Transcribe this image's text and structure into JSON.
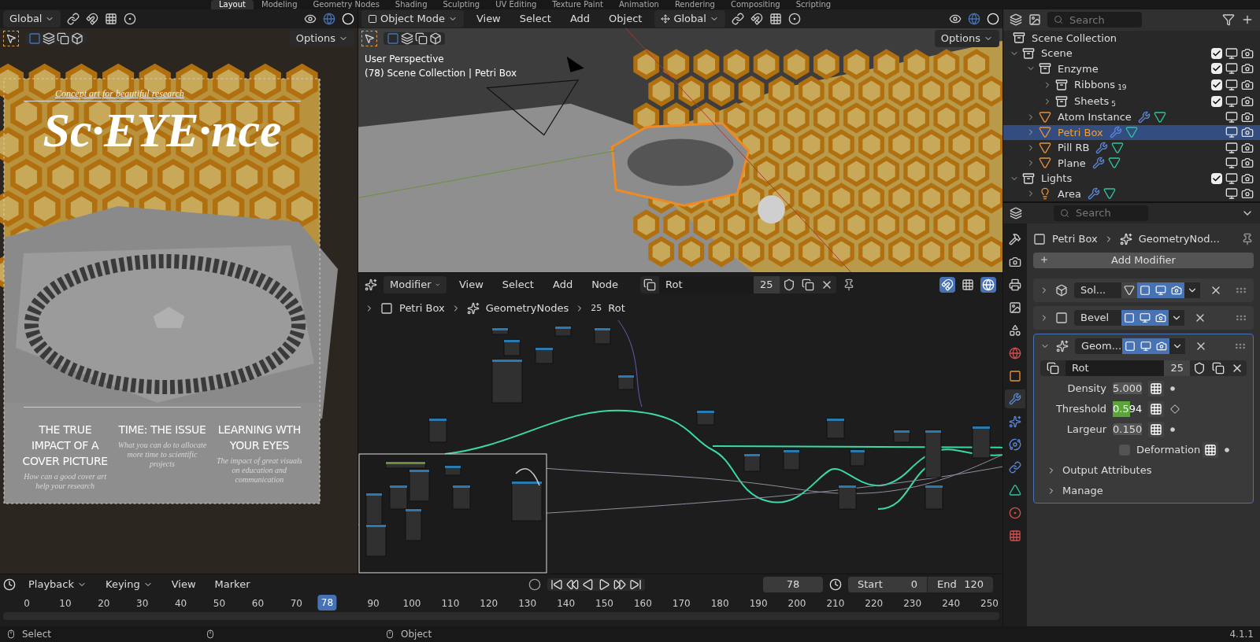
{
  "workspace_tabs": [
    {
      "label": "Layout",
      "selected": true
    },
    {
      "label": "Modeling",
      "selected": false
    },
    {
      "label": "Geometry Nodes",
      "selected": false
    },
    {
      "label": "Shading",
      "selected": false
    },
    {
      "label": "Sculpting",
      "selected": false
    },
    {
      "label": "UV Editing",
      "selected": false
    },
    {
      "label": "Texture Paint",
      "selected": false
    },
    {
      "label": "Animation",
      "selected": false
    },
    {
      "label": "Rendering",
      "selected": false
    },
    {
      "label": "Compositing",
      "selected": false
    },
    {
      "label": "Scripting",
      "selected": false
    }
  ],
  "camera_view": {
    "transform": "Global",
    "options": "Options",
    "poster": {
      "tagline": "Concept art for beautiful research",
      "title": "Sc·EYE·nce",
      "columns": [
        {
          "heading": "THE TRUE IMPACT OF A COVER PICTURE",
          "body": "How can a good cover art help your research"
        },
        {
          "heading": "TIME: THE ISSUE",
          "body": "What you can do to allocate more time to scientific projects"
        },
        {
          "heading": "LEARNING WTH YOUR EYES",
          "body": "The impact of great visuals on education and communication"
        }
      ]
    }
  },
  "viewport": {
    "mode": "Object Mode",
    "menus": [
      "View",
      "Select",
      "Add",
      "Object"
    ],
    "transform": "Global",
    "options": "Options",
    "overlay": [
      "User Perspective",
      "(78) Scene Collection | Petri Box"
    ]
  },
  "node_editor": {
    "editor_type": "Modifier",
    "menus": [
      "View",
      "Select",
      "Add",
      "Node"
    ],
    "node_group": "Rot",
    "users": "25",
    "breadcrumbs": [
      "Petri Box",
      "GeometryNodes"
    ],
    "group_users": "25",
    "group_name": "Rot"
  },
  "timeline": {
    "menus": [
      "Playback",
      "Keying",
      "View",
      "Marker"
    ],
    "current_frame": "78",
    "start_label": "Start",
    "start": "0",
    "end_label": "End",
    "end": "120",
    "ticks": [
      "0",
      "10",
      "20",
      "30",
      "40",
      "50",
      "60",
      "70",
      "90",
      "100",
      "110",
      "120",
      "130",
      "140",
      "150",
      "160",
      "170",
      "180",
      "190",
      "200",
      "210",
      "220",
      "230",
      "240",
      "250"
    ],
    "playhead": "78"
  },
  "outliner": {
    "search_placeholder": "Search",
    "root": "Scene Collection",
    "tree": [
      {
        "name": "Scene",
        "kind": "collection",
        "expanded": true,
        "checked": true,
        "selected": false,
        "children": [
          {
            "name": "Enzyme",
            "kind": "collection",
            "expanded": true,
            "checked": true,
            "selected": false,
            "children": [
              {
                "name": "Ribbons",
                "kind": "collection",
                "expanded": false,
                "checked": true,
                "selected": false,
                "count": "19"
              },
              {
                "name": "Sheets",
                "kind": "collection",
                "expanded": false,
                "checked": true,
                "selected": false,
                "count": "5"
              }
            ]
          },
          {
            "name": "Atom Instance",
            "kind": "mesh",
            "expanded": false,
            "selected": false
          },
          {
            "name": "Petri Box",
            "kind": "mesh",
            "expanded": false,
            "selected": true
          },
          {
            "name": "Pill RB",
            "kind": "mesh",
            "expanded": false,
            "selected": false
          },
          {
            "name": "Plane",
            "kind": "mesh",
            "expanded": false,
            "selected": false
          }
        ]
      },
      {
        "name": "Lights",
        "kind": "collection",
        "expanded": true,
        "checked": true,
        "selected": false,
        "children": [
          {
            "name": "Area",
            "kind": "light",
            "expanded": false,
            "selected": false
          }
        ]
      }
    ]
  },
  "properties": {
    "search_placeholder": "Search",
    "tabs": [
      {
        "kind": "tool",
        "selected": false
      },
      {
        "kind": "render",
        "selected": false
      },
      {
        "kind": "output",
        "selected": false
      },
      {
        "kind": "view_layer",
        "selected": false
      },
      {
        "kind": "scene",
        "selected": false
      },
      {
        "kind": "world",
        "selected": false
      },
      {
        "kind": "object",
        "selected": false
      },
      {
        "kind": "modifiers",
        "selected": true
      },
      {
        "kind": "particles",
        "selected": false
      },
      {
        "kind": "physics",
        "selected": false
      },
      {
        "kind": "constraints",
        "selected": false
      },
      {
        "kind": "data",
        "selected": false
      },
      {
        "kind": "material",
        "selected": false
      },
      {
        "kind": "texture",
        "selected": false
      }
    ],
    "breadcrumb": [
      "Petri Box",
      "GeometryNod..."
    ],
    "add_modifier": "Add Modifier",
    "modifiers": [
      {
        "name": "Sol...",
        "kind": "solidify",
        "expanded": false
      },
      {
        "name": "Bevel",
        "kind": "bevel",
        "expanded": false
      },
      {
        "name": "Geom...",
        "kind": "nodes",
        "expanded": true,
        "node_group": "Rot",
        "users": "25",
        "inputs": [
          {
            "label": "Density",
            "kind": "number",
            "value": "5.000"
          },
          {
            "label": "Threshold",
            "kind": "slider",
            "value": "0.594",
            "level": 0.58
          },
          {
            "label": "Largeur",
            "kind": "number",
            "value": "0.150"
          },
          {
            "label": "Deformation",
            "kind": "checkbox",
            "checked": false
          }
        ],
        "panels": [
          {
            "label": "Output Attributes",
            "expanded": false
          },
          {
            "label": "Manage",
            "expanded": false
          }
        ]
      }
    ]
  },
  "status_bar": {
    "items": [
      "Select",
      "Object"
    ],
    "version": "4.1.1"
  }
}
